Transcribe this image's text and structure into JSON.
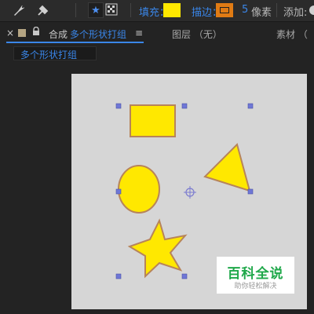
{
  "colors": {
    "accent": "#3a86e8",
    "fill": "#ffe800",
    "stroke": "#e07b14",
    "shape_outline": "#b7845a",
    "handle": "#6f77d6",
    "canvas_bg": "#d6d6d6",
    "watermark_green": "#1fa84a"
  },
  "toolbar": {
    "icons": [
      "pen-tool-icon",
      "puppet-pin-icon"
    ],
    "star_icon": "star-icon",
    "mask_icon": "mask-grid-icon",
    "fill_label": "填充：",
    "fill_color": "#ffe800",
    "stroke_label": "描边：",
    "stroke_color": "#e07b14",
    "stroke_width": "5",
    "stroke_unit": "像素",
    "add_label": "添加:"
  },
  "panel": {
    "close_glyph": "×",
    "comp_prefix": "合成",
    "comp_name": "多个形状打组",
    "menu_glyph": "≡",
    "layer_label": "图层 （无）",
    "footage_label": "素材 （"
  },
  "breadcrumb": {
    "label": "多个形状打组"
  },
  "watermark": {
    "title": "百科全说",
    "subtitle": "助你轻松解决"
  }
}
